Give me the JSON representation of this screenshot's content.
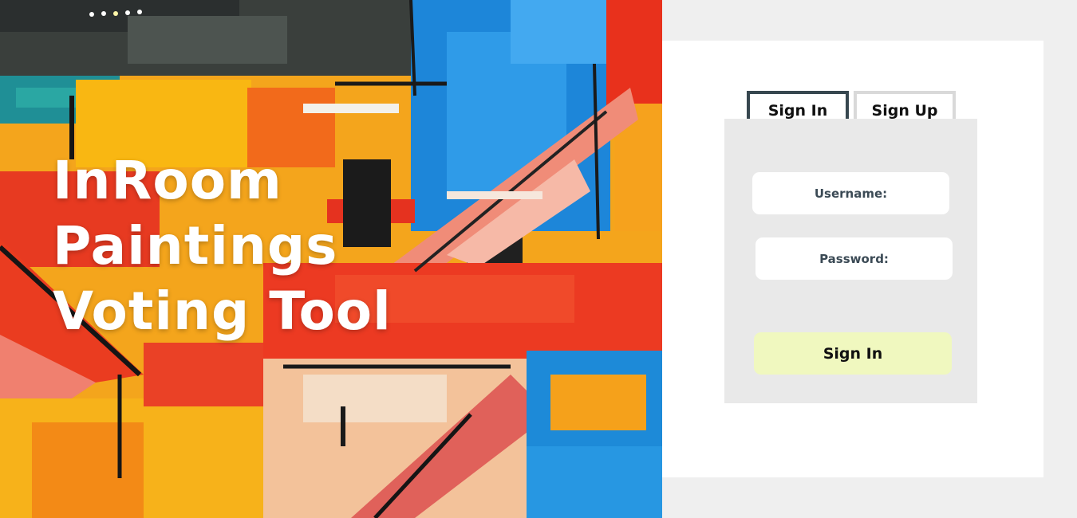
{
  "hero": {
    "title_line1": "InRoom",
    "title_line2": "Paintings",
    "title_line3": "Voting Tool",
    "image": "abstract-oil-painting"
  },
  "auth": {
    "tabs": [
      {
        "label": "Sign In",
        "active": true
      },
      {
        "label": "Sign Up",
        "active": false
      }
    ],
    "username_placeholder": "Username:",
    "password_placeholder": "Password:",
    "submit_label": "Sign In"
  },
  "colors": {
    "page_background": "#efefef",
    "card_background": "#ffffff",
    "form_panel": "#e9e9e9",
    "active_tab_border": "#37474f",
    "inactive_tab_border": "#d9d9d9",
    "submit_button": "#f0f8bf",
    "hero_text": "#ffffff"
  }
}
